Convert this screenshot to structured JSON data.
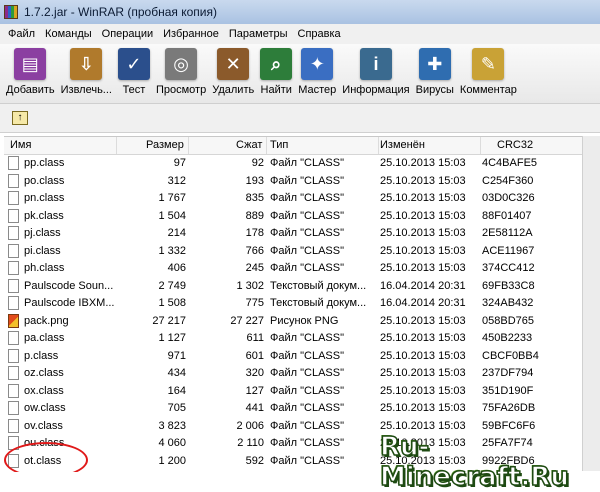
{
  "window": {
    "title": "1.7.2.jar - WinRAR (пробная копия)"
  },
  "menu": [
    "Файл",
    "Команды",
    "Операции",
    "Избранное",
    "Параметры",
    "Справка"
  ],
  "toolbar": [
    {
      "label": "Добавить",
      "icon": "archive-add-icon",
      "color": "#8b3fa1",
      "glyph": "▤"
    },
    {
      "label": "Извлечь...",
      "icon": "extract-icon",
      "color": "#b07a2c",
      "glyph": "⇩"
    },
    {
      "label": "Тест",
      "icon": "test-icon",
      "color": "#2b4f8c",
      "glyph": "✓"
    },
    {
      "label": "Просмотр",
      "icon": "view-icon",
      "color": "#7a7a7a",
      "glyph": "◎"
    },
    {
      "label": "Удалить",
      "icon": "delete-icon",
      "color": "#8b5a2b",
      "glyph": "✕"
    },
    {
      "label": "Найти",
      "icon": "find-icon",
      "color": "#2d7d3a",
      "glyph": "⌕"
    },
    {
      "label": "Мастер",
      "icon": "wizard-icon",
      "color": "#3a6ec2",
      "glyph": "✦"
    },
    {
      "label": "Информация",
      "icon": "info-icon",
      "color": "#3a6a8f",
      "glyph": "i"
    },
    {
      "label": "Вирусы",
      "icon": "virus-icon",
      "color": "#2f6db0",
      "glyph": "✚"
    },
    {
      "label": "Комментар",
      "icon": "comment-icon",
      "color": "#c9a236",
      "glyph": "✎"
    }
  ],
  "columns": {
    "name": "Имя",
    "size": "Размер",
    "packed": "Сжат",
    "type": "Тип",
    "modified": "Изменён",
    "crc": "CRC32"
  },
  "files": [
    {
      "name": "pp.class",
      "size": "97",
      "packed": "92",
      "type": "Файл \"CLASS\"",
      "modified": "25.10.2013 15:03",
      "crc": "4C4BAFE5",
      "kind": "class"
    },
    {
      "name": "po.class",
      "size": "312",
      "packed": "193",
      "type": "Файл \"CLASS\"",
      "modified": "25.10.2013 15:03",
      "crc": "C254F360",
      "kind": "class"
    },
    {
      "name": "pn.class",
      "size": "1 767",
      "packed": "835",
      "type": "Файл \"CLASS\"",
      "modified": "25.10.2013 15:03",
      "crc": "03D0C326",
      "kind": "class"
    },
    {
      "name": "pk.class",
      "size": "1 504",
      "packed": "889",
      "type": "Файл \"CLASS\"",
      "modified": "25.10.2013 15:03",
      "crc": "88F01407",
      "kind": "class"
    },
    {
      "name": "pj.class",
      "size": "214",
      "packed": "178",
      "type": "Файл \"CLASS\"",
      "modified": "25.10.2013 15:03",
      "crc": "2E58112A",
      "kind": "class"
    },
    {
      "name": "pi.class",
      "size": "1 332",
      "packed": "766",
      "type": "Файл \"CLASS\"",
      "modified": "25.10.2013 15:03",
      "crc": "ACE11967",
      "kind": "class"
    },
    {
      "name": "ph.class",
      "size": "406",
      "packed": "245",
      "type": "Файл \"CLASS\"",
      "modified": "25.10.2013 15:03",
      "crc": "374CC412",
      "kind": "class"
    },
    {
      "name": "Paulscode Soun...",
      "size": "2 749",
      "packed": "1 302",
      "type": "Текстовый докум...",
      "modified": "16.04.2014 20:31",
      "crc": "69FB33C8",
      "kind": "text"
    },
    {
      "name": "Paulscode IBXM...",
      "size": "1 508",
      "packed": "775",
      "type": "Текстовый докум...",
      "modified": "16.04.2014 20:31",
      "crc": "324AB432",
      "kind": "text"
    },
    {
      "name": "pack.png",
      "size": "27 217",
      "packed": "27 227",
      "type": "Рисунок PNG",
      "modified": "25.10.2013 15:03",
      "crc": "058BD765",
      "kind": "png"
    },
    {
      "name": "pa.class",
      "size": "1 127",
      "packed": "611",
      "type": "Файл \"CLASS\"",
      "modified": "25.10.2013 15:03",
      "crc": "450B2233",
      "kind": "class"
    },
    {
      "name": "p.class",
      "size": "971",
      "packed": "601",
      "type": "Файл \"CLASS\"",
      "modified": "25.10.2013 15:03",
      "crc": "CBCF0BB4",
      "kind": "class"
    },
    {
      "name": "oz.class",
      "size": "434",
      "packed": "320",
      "type": "Файл \"CLASS\"",
      "modified": "25.10.2013 15:03",
      "crc": "237DF794",
      "kind": "class"
    },
    {
      "name": "ox.class",
      "size": "164",
      "packed": "127",
      "type": "Файл \"CLASS\"",
      "modified": "25.10.2013 15:03",
      "crc": "351D190F",
      "kind": "class"
    },
    {
      "name": "ow.class",
      "size": "705",
      "packed": "441",
      "type": "Файл \"CLASS\"",
      "modified": "25.10.2013 15:03",
      "crc": "75FA26DB",
      "kind": "class"
    },
    {
      "name": "ov.class",
      "size": "3 823",
      "packed": "2 006",
      "type": "Файл \"CLASS\"",
      "modified": "25.10.2013 15:03",
      "crc": "59BFC6F6",
      "kind": "class"
    },
    {
      "name": "ou.class",
      "size": "4 060",
      "packed": "2 110",
      "type": "Файл \"CLASS\"",
      "modified": "25.10.2013 15:03",
      "crc": "25FA7F74",
      "kind": "class"
    },
    {
      "name": "ot.class",
      "size": "1 200",
      "packed": "592",
      "type": "Файл \"CLASS\"",
      "modified": "25.10.2013 15:03",
      "crc": "9922FBD6",
      "kind": "class"
    }
  ],
  "watermark": "Ru-Minecraft.Ru",
  "colors": {
    "titlebar": "#b8cde9",
    "highlight": "#e01919"
  }
}
